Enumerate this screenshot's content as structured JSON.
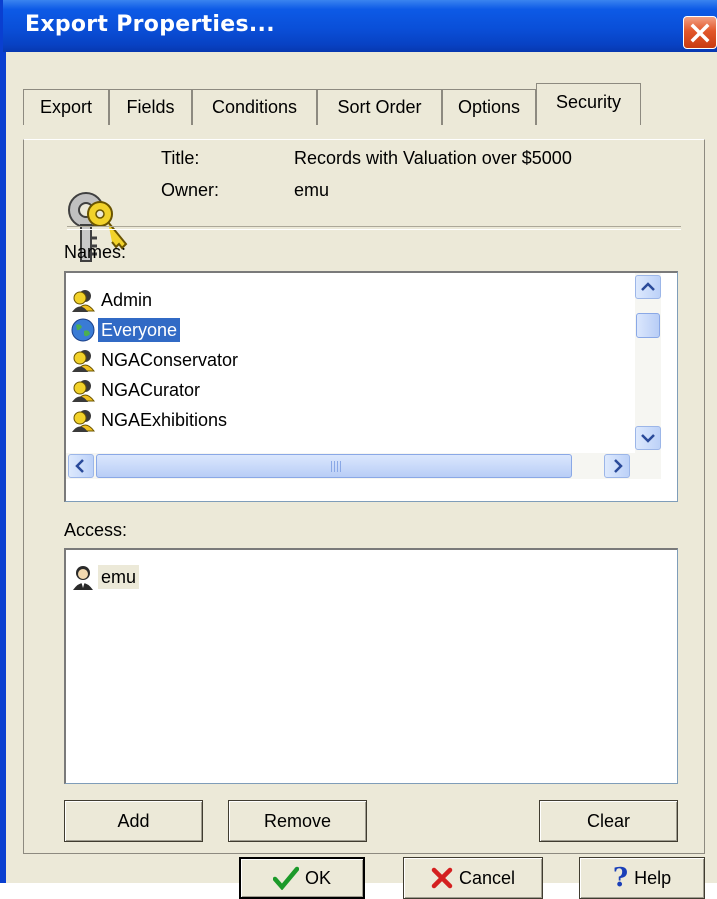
{
  "window": {
    "title": "Export Properties...",
    "close_icon": "close-icon"
  },
  "tabs": [
    {
      "label": "Export"
    },
    {
      "label": "Fields"
    },
    {
      "label": "Conditions"
    },
    {
      "label": "Sort Order"
    },
    {
      "label": "Options"
    },
    {
      "label": "Security",
      "active": true
    }
  ],
  "info": {
    "icon": "keys-icon",
    "title_label": "Title:",
    "title_value": "Records with Valuation over $5000",
    "owner_label": "Owner:",
    "owner_value": "emu"
  },
  "names": {
    "label": "Names:",
    "items": [
      {
        "label": "Admin",
        "icon": "group-icon"
      },
      {
        "label": "Everyone",
        "icon": "globe-icon",
        "selected": true
      },
      {
        "label": "NGAConservator",
        "icon": "group-icon"
      },
      {
        "label": "NGACurator",
        "icon": "group-icon"
      },
      {
        "label": "NGAExhibitions",
        "icon": "group-icon"
      }
    ]
  },
  "access": {
    "label": "Access:",
    "items": [
      {
        "label": "emu",
        "icon": "user-icon"
      }
    ]
  },
  "buttons": {
    "add": "Add",
    "remove": "Remove",
    "clear": "Clear",
    "ok": "OK",
    "cancel": "Cancel",
    "help": "Help"
  },
  "colors": {
    "titlebar": "#0a4fd8",
    "dialog": "#ece9d8",
    "selection": "#316ac5"
  }
}
